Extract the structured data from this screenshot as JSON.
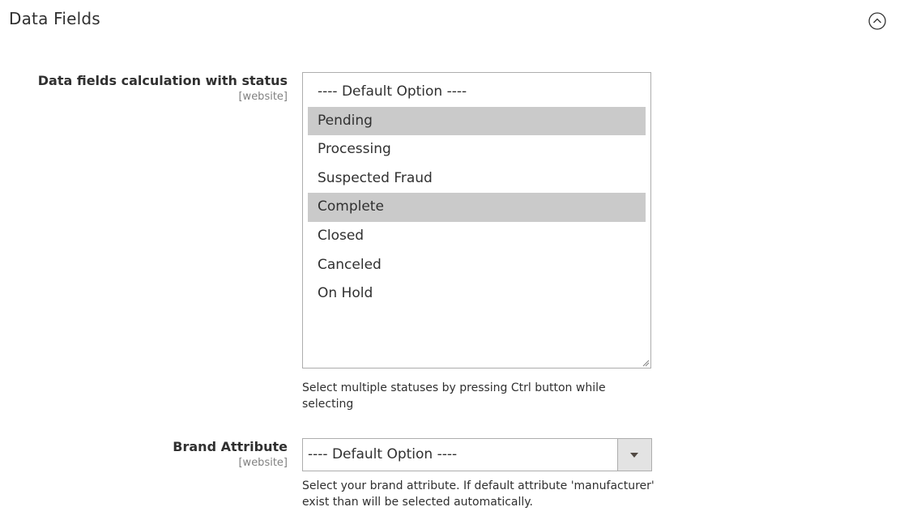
{
  "section": {
    "title": "Data Fields",
    "collapse_icon": "chevron-up-circle-icon"
  },
  "status_field": {
    "label": "Data fields calculation with status",
    "scope": "[website]",
    "options": [
      {
        "label": "---- Default Option ----",
        "selected": false
      },
      {
        "label": "Pending",
        "selected": true
      },
      {
        "label": "Processing",
        "selected": false
      },
      {
        "label": "Suspected Fraud",
        "selected": false
      },
      {
        "label": "Complete",
        "selected": true
      },
      {
        "label": "Closed",
        "selected": false
      },
      {
        "label": "Canceled",
        "selected": false
      },
      {
        "label": "On Hold",
        "selected": false
      }
    ],
    "note": "Select multiple statuses by pressing Ctrl button while selecting"
  },
  "brand_field": {
    "label": "Brand Attribute",
    "scope": "[website]",
    "selected_value": "---- Default Option ----",
    "arrow_icon": "triangle-down-icon",
    "note": "Select your brand attribute. If default attribute 'manufacturer' exist than will be selected automatically."
  },
  "colors": {
    "selected_option_bg": "#cacaca",
    "border": "#adadad",
    "text": "#303030",
    "scope_text": "#808080"
  }
}
